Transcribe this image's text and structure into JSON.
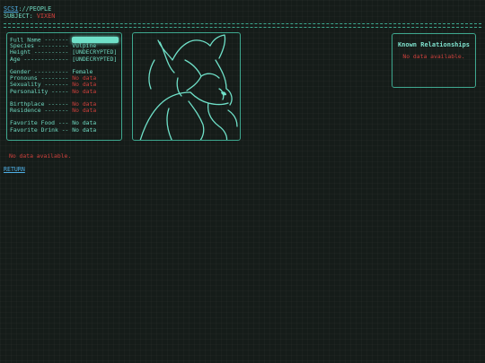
{
  "header": {
    "breadcrumb_link": "SCSI",
    "breadcrumb_rest": "://PEOPLE",
    "subject_label": "SUBJECT: ",
    "subject_value": "VIXEN"
  },
  "profile": [
    {
      "label": "Full Name -------",
      "value": "",
      "redacted": true,
      "status": "normal"
    },
    {
      "label": "Species ---------",
      "value": "Vulpine",
      "status": "normal"
    },
    {
      "label": "Height ----------",
      "value": "[UNDECRYPTED]",
      "status": "normal"
    },
    {
      "label": "Age -------------",
      "value": "[UNDECRYPTED]",
      "status": "normal"
    },
    {
      "gap": true
    },
    {
      "label": "Gender ----------",
      "value": "Female",
      "status": "normal"
    },
    {
      "label": "Pronouns --------",
      "value": "No data",
      "status": "missing"
    },
    {
      "label": "Sexuality -------",
      "value": "No data",
      "status": "missing"
    },
    {
      "label": "Personality -----",
      "value": "No data",
      "status": "missing"
    },
    {
      "gap": true
    },
    {
      "label": "Birthplace ------",
      "value": "No data",
      "status": "missing"
    },
    {
      "label": "Residence -------",
      "value": "No data",
      "status": "missing"
    },
    {
      "gap": true
    },
    {
      "label": "Favorite Food ---",
      "value": "No data",
      "status": "normal"
    },
    {
      "label": "Favorite Drink --",
      "value": "No data",
      "status": "normal"
    }
  ],
  "relationships": {
    "title": "Known Relationships",
    "empty": "No data available."
  },
  "notes": {
    "empty": "No data available."
  },
  "nav": {
    "return_label": "RETURN"
  },
  "colors": {
    "accent": "#6fd8c0",
    "border": "#3ea88f",
    "missing": "#d0403c",
    "link": "#4fb0e6",
    "background": "#151c19"
  }
}
